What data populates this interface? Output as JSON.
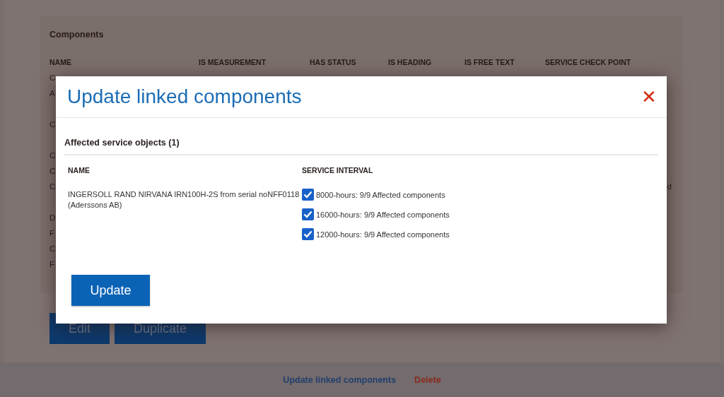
{
  "page": {
    "section_title": "Components",
    "columns": [
      "NAME",
      "IS MEASUREMENT",
      "HAS STATUS",
      "IS HEADING",
      "IS FREE TEXT",
      "SERVICE CHECK POINT"
    ],
    "row_groups": [
      {
        "lines": [
          {
            "name": "C"
          },
          {
            "name": "A"
          }
        ]
      },
      {
        "lines": [
          {
            "name": "C"
          }
        ]
      },
      {
        "lines": [
          {
            "name": "C"
          },
          {
            "name": "C"
          },
          {
            "name": "C",
            "description": "d"
          }
        ]
      },
      {
        "lines": [
          {
            "name": "D"
          },
          {
            "name": "F"
          },
          {
            "name": "C"
          },
          {
            "name": "F"
          }
        ]
      }
    ],
    "buttons": [
      "Edit",
      "Duplicate"
    ],
    "footer_links": [
      {
        "label": "Update linked components",
        "kind": "normal"
      },
      {
        "label": "Delete",
        "kind": "danger"
      }
    ]
  },
  "dialog": {
    "title": "Update linked components",
    "close": "✕",
    "section_title": "Affected service objects (1)",
    "columns": [
      "NAME",
      "SERVICE INTERVAL"
    ],
    "objects": [
      {
        "name": "INGERSOLL RAND NIRVANA IRN100H-2S from serial noNFF0118 (Aderssons AB)",
        "intervals": [
          {
            "label": "8000-hours: 9/9 Affected components",
            "checked": true
          },
          {
            "label": "16000-hours: 9/9 Affected components",
            "checked": true
          },
          {
            "label": "12000-hours: 9/9 Affected components",
            "checked": true
          }
        ]
      }
    ],
    "button": "Update"
  }
}
